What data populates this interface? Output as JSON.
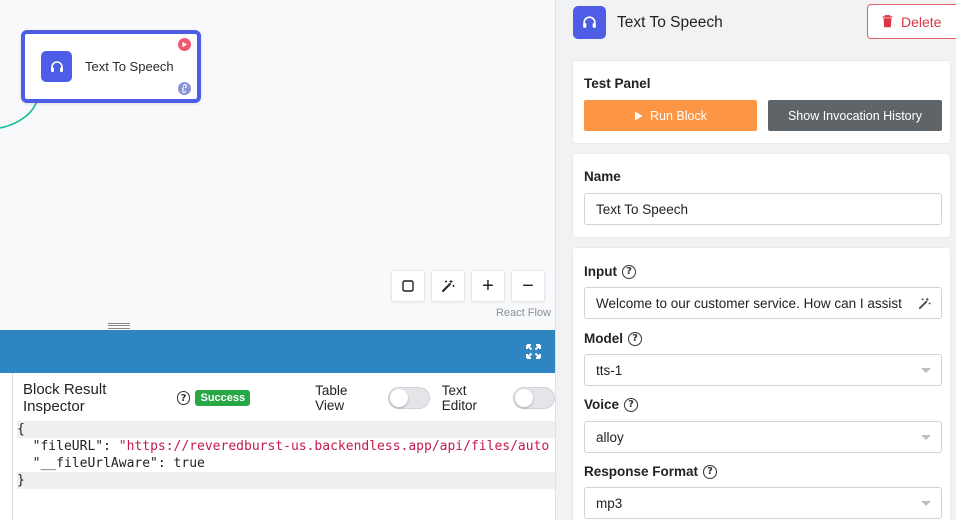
{
  "canvas": {
    "node": {
      "title": "Text To Speech",
      "icon": "headset-icon"
    },
    "controls": [
      {
        "name": "fit-view-button",
        "icon": "square-icon"
      },
      {
        "name": "auto-layout-button",
        "icon": "magic-wand-icon"
      },
      {
        "name": "zoom-in-button",
        "label": "+"
      },
      {
        "name": "zoom-out-button",
        "label": "−"
      }
    ],
    "attribution": "React Flow",
    "edge_color": "#1abc9c"
  },
  "inspector": {
    "title": "Block Result Inspector",
    "status": "Success",
    "table_view_label": "Table View",
    "text_editor_label": "Text Editor",
    "json": {
      "open": "{",
      "line1_key": "\"fileURL\"",
      "line1_value": "\"https://reveredburst-us.backendless.app/api/files/auto",
      "line2_key": "\"__fileUrlAware\"",
      "line2_value": "true",
      "close": "}"
    },
    "bar_color": "#2d85c1"
  },
  "panel": {
    "title": "Text To Speech",
    "delete_label": "Delete",
    "test_panel": {
      "label": "Test Panel",
      "run_label": "Run Block",
      "history_label": "Show Invocation History"
    },
    "name": {
      "label": "Name",
      "value": "Text To Speech"
    },
    "input": {
      "label": "Input",
      "value": "Welcome to our customer service. How can I assist you today?"
    },
    "model": {
      "label": "Model",
      "value": "tts-1"
    },
    "voice": {
      "label": "Voice",
      "value": "alloy"
    },
    "response_format": {
      "label": "Response Format",
      "value": "mp3"
    },
    "colors": {
      "accent": "#4e5de5",
      "run": "#fd9644",
      "history": "#5f6468",
      "danger": "#dc3545"
    }
  }
}
